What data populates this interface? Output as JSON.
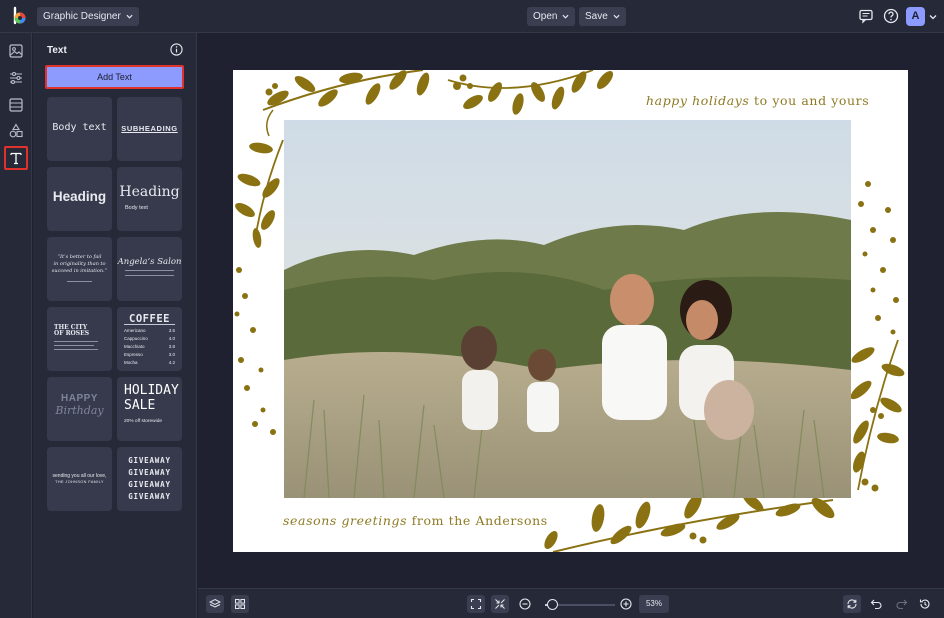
{
  "app": {
    "project_title": "Graphic Designer",
    "menu": {
      "open_label": "Open",
      "save_label": "Save"
    },
    "user_initial": "A"
  },
  "panel": {
    "title": "Text",
    "add_text_label": "Add Text",
    "tiles": [
      {
        "lines": [
          "Body text"
        ]
      },
      {
        "lines": [
          "SUBHEADING"
        ]
      },
      {
        "lines": [
          "Heading"
        ]
      },
      {
        "lines": [
          "Heading",
          "Body text"
        ]
      },
      {
        "lines": [
          "“It’s better to fail",
          "in originality than to",
          "succeed in imitation.”"
        ]
      },
      {
        "lines": [
          "Angela’s Salon"
        ]
      },
      {
        "lines": [
          "THE CITY",
          "OF ROSES"
        ]
      },
      {
        "lines": [
          "COFFEE",
          "Americano",
          "Cappuccino",
          "Macchiato",
          "Espresso",
          "Mocha"
        ],
        "prices": [
          "3.5",
          "4.0",
          "3.8",
          "3.0",
          "4.2"
        ]
      },
      {
        "lines": [
          "HAPPY",
          "Birthday"
        ]
      },
      {
        "lines": [
          "HOLIDAY",
          "SALE",
          "20% off storewide"
        ]
      },
      {
        "lines": [
          "sending you all our love,",
          "THE JOHNSON FAMILY"
        ]
      },
      {
        "lines": [
          "GIVEAWAY",
          "GIVEAWAY",
          "GIVEAWAY",
          "GIVEAWAY"
        ]
      }
    ]
  },
  "card": {
    "top_script": "happy holidays",
    "top_rest": " to you and yours",
    "bottom_script": "seasons greetings",
    "bottom_rest": " from the Andersons",
    "accent_color": "#8e7a23"
  },
  "zoom": {
    "level_label": "53%",
    "level": 0.53
  },
  "colors": {
    "accent": "#8d9bff",
    "highlight": "#e0322b",
    "background": "#1f2130"
  }
}
